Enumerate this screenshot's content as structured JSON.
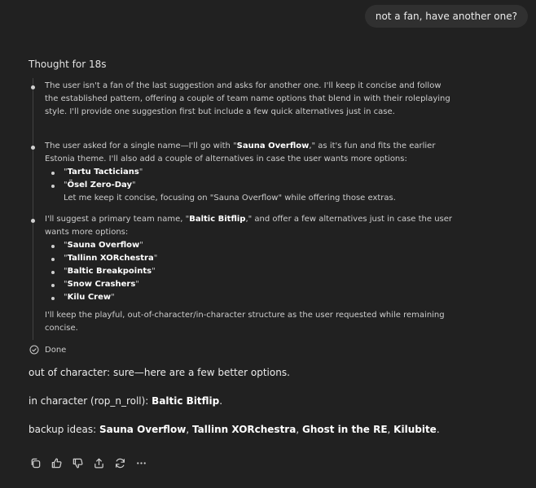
{
  "conversation": {
    "user_message": "not a fan, have another one?",
    "thought_title": "Thought for 18s",
    "trace": {
      "item1": "The user isn't a fan of the last suggestion and asks for another one. I'll keep it concise and follow the established pattern, offering a couple of team name options that blend in with their roleplaying style. I'll provide one suggestion first but include a few quick alternatives just in case.",
      "item2_pre": "The user asked for a single name—I'll go with \"",
      "item2_name": "Sauna Overflow",
      "item2_post": ",\" as it's fun and fits the earlier Estonia theme. I'll also add a couple of alternatives in case the user wants more options:",
      "item2_options": [
        "Tartu Tacticians",
        "Ösel Zero-Day"
      ],
      "item2_note": "Let me keep it concise, focusing on \"Sauna Overflow\" while offering those extras.",
      "item3_pre": "I'll suggest a primary team name, \"",
      "item3_name": "Baltic Bitflip",
      "item3_post": ",\" and offer a few alternatives just in case the user wants more options:",
      "item3_options": [
        "Sauna Overflow",
        "Tallinn XORchestra",
        "Baltic Breakpoints",
        "Snow Crashers",
        "Kilu Crew"
      ],
      "item3_note": "I'll keep the playful, out-of-character/in-character structure as the user requested while remaining concise."
    },
    "done_label": "Done",
    "answer": {
      "ooc": "out of character: sure—here are a few better options.",
      "ic_prefix": "in character (rop_n_roll): ",
      "ic_name": "Baltic Bitflip",
      "ic_suffix": ".",
      "backup_prefix": "backup ideas: ",
      "backup_items": [
        "Sauna Overflow",
        "Tallinn XORchestra",
        "Ghost in the RE",
        "Kilubite"
      ],
      "separator": ", ",
      "backup_suffix": "."
    }
  },
  "toolbar": {
    "icons": [
      "copy-icon",
      "thumbs-up-icon",
      "thumbs-down-icon",
      "share-icon",
      "regenerate-icon",
      "more-icon"
    ]
  },
  "colors": {
    "background": "#212121",
    "bubble": "#303030",
    "text": "#ececec",
    "muted": "#cdcdcd"
  }
}
